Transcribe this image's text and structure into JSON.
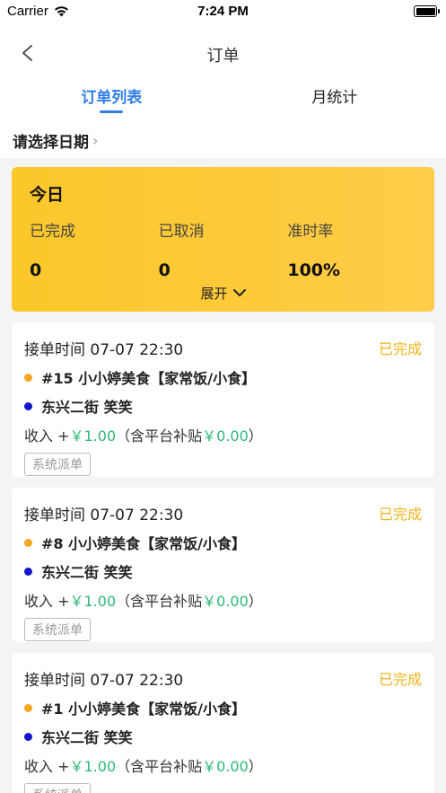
{
  "status_bar": {
    "carrier": "Carrier",
    "time": "7:24 PM"
  },
  "nav": {
    "title": "订单"
  },
  "tabs": [
    {
      "label": "订单列表",
      "active": true
    },
    {
      "label": "月统计",
      "active": false
    }
  ],
  "date_picker": {
    "label": "请选择日期"
  },
  "summary": {
    "title": "今日",
    "stats": [
      {
        "label": "已完成",
        "value": "0"
      },
      {
        "label": "已取消",
        "value": "0"
      },
      {
        "label": "准时率",
        "value": "100%"
      }
    ],
    "expand_label": "展开"
  },
  "orders": [
    {
      "time": "接单时间 07-07 22:30",
      "status": "已完成",
      "shop": "#15 小小婷美食【家常饭/小食】",
      "customer": "东兴二街 笑笑",
      "income_prefix": "收入 +",
      "income": "￥1.00",
      "subsidy_prefix": "（含平台补贴",
      "subsidy": "￥0.00",
      "subsidy_suffix": "）",
      "tag": "系统派单"
    },
    {
      "time": "接单时间 07-07 22:30",
      "status": "已完成",
      "shop": "#8 小小婷美食【家常饭/小食】",
      "customer": "东兴二街 笑笑",
      "income_prefix": "收入 +",
      "income": "￥1.00",
      "subsidy_prefix": "（含平台补贴",
      "subsidy": "￥0.00",
      "subsidy_suffix": "）",
      "tag": "系统派单"
    },
    {
      "time": "接单时间 07-07 22:30",
      "status": "已完成",
      "shop": "#1 小小婷美食【家常饭/小食】",
      "customer": "东兴二街 笑笑",
      "income_prefix": "收入 +",
      "income": "￥1.00",
      "subsidy_prefix": "（含平台补贴",
      "subsidy": "￥0.00",
      "subsidy_suffix": "）",
      "tag": "系统派单"
    }
  ],
  "colors": {
    "accent_blue": "#2e7ee6",
    "summary_yellow": "#fcc72a",
    "status_orange": "#f0b31a",
    "income_green": "#2cb978"
  }
}
